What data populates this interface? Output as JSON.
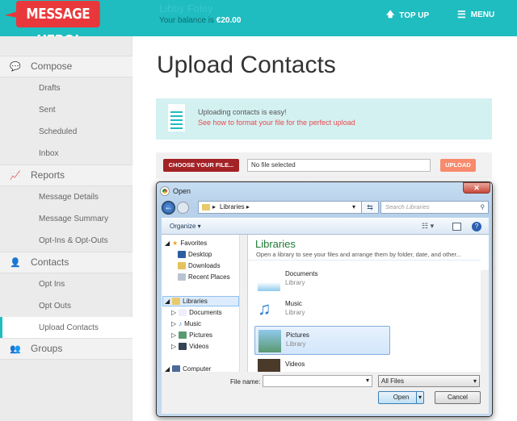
{
  "header": {
    "logo": "MESSAGE HERO!",
    "username": "Libby Foley",
    "balance_prefix": "Your balance is",
    "balance": "€20.00",
    "topup": "TOP UP",
    "menu": "MENU",
    "color": "#1fbcc0"
  },
  "sidebar": {
    "sections": [
      {
        "label": "Compose",
        "icon": "chat-icon",
        "items": [
          "Drafts",
          "Sent",
          "Scheduled",
          "Inbox"
        ]
      },
      {
        "label": "Reports",
        "icon": "chart-icon",
        "items": [
          "Message Details",
          "Message Summary",
          "Opt-Ins & Opt-Outs"
        ]
      },
      {
        "label": "Contacts",
        "icon": "person-icon",
        "items": [
          "Opt Ins",
          "Opt Outs",
          "Upload Contacts"
        ]
      },
      {
        "label": "Groups",
        "icon": "group-icon",
        "items": []
      }
    ],
    "active": "Upload Contacts"
  },
  "main": {
    "title": "Upload Contacts",
    "info_text": "Uploading contacts is easy!",
    "info_link": "See how to format your file for the perfect upload",
    "choose_label": "CHOOSE YOUR FILE...",
    "file_value": "No file selected",
    "upload_label": "UPLOAD"
  },
  "dialog": {
    "title": "Open",
    "close": "✕",
    "address": "Libraries",
    "search_placeholder": "Search Libraries",
    "organize": "Organize ▾",
    "nav": {
      "favorites": "Favorites",
      "fav_items": [
        "Desktop",
        "Downloads",
        "Recent Places"
      ],
      "libraries": "Libraries",
      "lib_items": [
        "Documents",
        "Music",
        "Pictures",
        "Videos"
      ],
      "computer": "Computer"
    },
    "heading": "Libraries",
    "description": "Open a library to see your files and arrange them by folder, date, and other...",
    "items": [
      {
        "name": "Documents",
        "sub": "Library"
      },
      {
        "name": "Music",
        "sub": "Library"
      },
      {
        "name": "Pictures",
        "sub": "Library"
      },
      {
        "name": "Videos",
        "sub": ""
      }
    ],
    "selected": "Pictures",
    "file_name_label": "File name:",
    "file_name_value": "",
    "filter": "All Files",
    "open": "Open",
    "cancel": "Cancel"
  }
}
